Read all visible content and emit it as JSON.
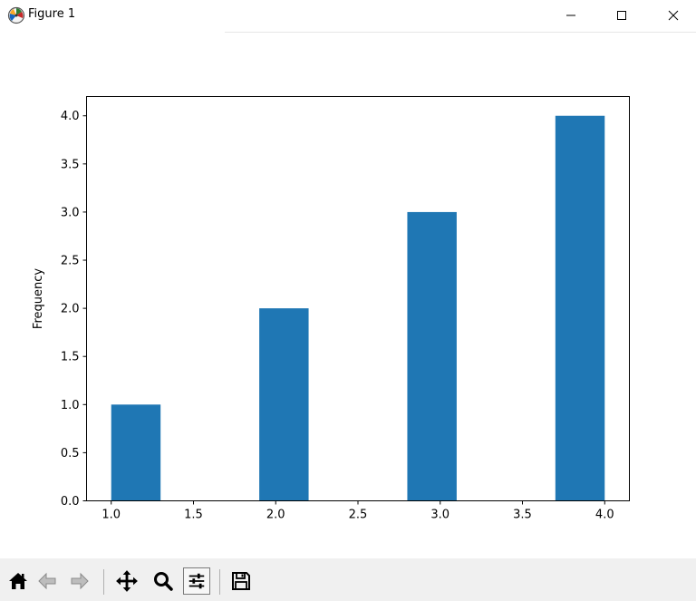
{
  "window": {
    "title": "Figure 1",
    "controls": [
      "minimize",
      "maximize",
      "close"
    ]
  },
  "toolbar": {
    "buttons": [
      {
        "name": "home",
        "icon": "home-icon"
      },
      {
        "name": "back",
        "icon": "arrow-left-icon"
      },
      {
        "name": "forward",
        "icon": "arrow-right-icon"
      },
      {
        "name": "pan",
        "icon": "move-icon"
      },
      {
        "name": "zoom",
        "icon": "magnifier-icon"
      },
      {
        "name": "configure-subplots",
        "icon": "sliders-icon"
      },
      {
        "name": "save",
        "icon": "floppy-disk-icon"
      }
    ]
  },
  "chart_data": {
    "type": "bar",
    "title": "",
    "xlabel": "",
    "ylabel": "Frequency",
    "bins": [
      {
        "start": 1.0,
        "end": 1.3,
        "value": 1.0
      },
      {
        "start": 1.3,
        "end": 1.6,
        "value": 0.0
      },
      {
        "start": 1.6,
        "end": 1.9,
        "value": 0.0
      },
      {
        "start": 1.9,
        "end": 2.2,
        "value": 2.0
      },
      {
        "start": 2.2,
        "end": 2.5,
        "value": 0.0
      },
      {
        "start": 2.5,
        "end": 2.8,
        "value": 0.0
      },
      {
        "start": 2.8,
        "end": 3.1,
        "value": 3.0
      },
      {
        "start": 3.1,
        "end": 3.4,
        "value": 0.0
      },
      {
        "start": 3.4,
        "end": 3.7,
        "value": 0.0
      },
      {
        "start": 3.7,
        "end": 4.0,
        "value": 4.0
      }
    ],
    "xlim": [
      0.85,
      4.15
    ],
    "ylim": [
      0,
      4.2
    ],
    "xticks": [
      "1.0",
      "1.5",
      "2.0",
      "2.5",
      "3.0",
      "3.5",
      "4.0"
    ],
    "yticks": [
      "0.0",
      "0.5",
      "1.0",
      "1.5",
      "2.0",
      "2.5",
      "3.0",
      "3.5",
      "4.0"
    ],
    "bar_color": "#1f77b4",
    "grid": false,
    "legend": false
  }
}
